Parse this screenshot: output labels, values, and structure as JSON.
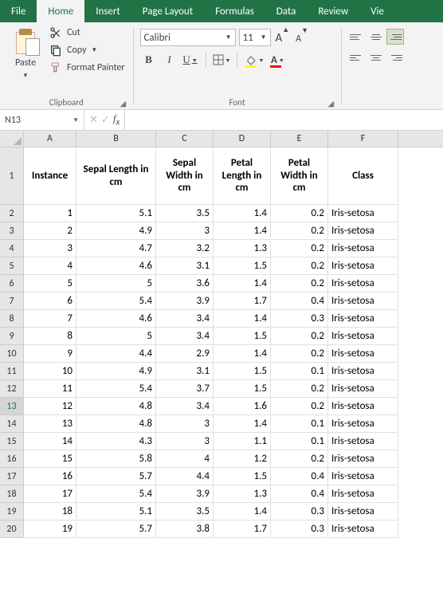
{
  "menu": {
    "items": [
      "File",
      "Home",
      "Insert",
      "Page Layout",
      "Formulas",
      "Data",
      "Review",
      "Vie"
    ],
    "activeIndex": 1
  },
  "ribbon": {
    "clipboard": {
      "paste": "Paste",
      "cut": "Cut",
      "copy": "Copy",
      "formatPainter": "Format Painter",
      "groupLabel": "Clipboard"
    },
    "font": {
      "name": "Calibri",
      "size": "11",
      "groupLabel": "Font"
    }
  },
  "fxbar": {
    "nameBox": "N13",
    "formula": ""
  },
  "grid": {
    "colWidths": {
      "A": 66,
      "B": 100,
      "C": 72,
      "D": 72,
      "E": 72,
      "F": 88
    },
    "columns": [
      "A",
      "B",
      "C",
      "D",
      "E",
      "F"
    ],
    "headerRowHeight": 72,
    "dataRowHeight": 22,
    "selectedRowHeader": 13,
    "headers": [
      "Instance",
      "Sepal Length in cm",
      "Sepal Width in cm",
      "Petal Length in cm",
      "Petal Width in cm",
      "Class"
    ],
    "rows": [
      {
        "r": 2,
        "v": [
          "1",
          "5.1",
          "3.5",
          "1.4",
          "0.2",
          "Iris-setosa"
        ]
      },
      {
        "r": 3,
        "v": [
          "2",
          "4.9",
          "3",
          "1.4",
          "0.2",
          "Iris-setosa"
        ]
      },
      {
        "r": 4,
        "v": [
          "3",
          "4.7",
          "3.2",
          "1.3",
          "0.2",
          "Iris-setosa"
        ]
      },
      {
        "r": 5,
        "v": [
          "4",
          "4.6",
          "3.1",
          "1.5",
          "0.2",
          "Iris-setosa"
        ]
      },
      {
        "r": 6,
        "v": [
          "5",
          "5",
          "3.6",
          "1.4",
          "0.2",
          "Iris-setosa"
        ]
      },
      {
        "r": 7,
        "v": [
          "6",
          "5.4",
          "3.9",
          "1.7",
          "0.4",
          "Iris-setosa"
        ]
      },
      {
        "r": 8,
        "v": [
          "7",
          "4.6",
          "3.4",
          "1.4",
          "0.3",
          "Iris-setosa"
        ]
      },
      {
        "r": 9,
        "v": [
          "8",
          "5",
          "3.4",
          "1.5",
          "0.2",
          "Iris-setosa"
        ]
      },
      {
        "r": 10,
        "v": [
          "9",
          "4.4",
          "2.9",
          "1.4",
          "0.2",
          "Iris-setosa"
        ]
      },
      {
        "r": 11,
        "v": [
          "10",
          "4.9",
          "3.1",
          "1.5",
          "0.1",
          "Iris-setosa"
        ]
      },
      {
        "r": 12,
        "v": [
          "11",
          "5.4",
          "3.7",
          "1.5",
          "0.2",
          "Iris-setosa"
        ]
      },
      {
        "r": 13,
        "v": [
          "12",
          "4.8",
          "3.4",
          "1.6",
          "0.2",
          "Iris-setosa"
        ]
      },
      {
        "r": 14,
        "v": [
          "13",
          "4.8",
          "3",
          "1.4",
          "0.1",
          "Iris-setosa"
        ]
      },
      {
        "r": 15,
        "v": [
          "14",
          "4.3",
          "3",
          "1.1",
          "0.1",
          "Iris-setosa"
        ]
      },
      {
        "r": 16,
        "v": [
          "15",
          "5.8",
          "4",
          "1.2",
          "0.2",
          "Iris-setosa"
        ]
      },
      {
        "r": 17,
        "v": [
          "16",
          "5.7",
          "4.4",
          "1.5",
          "0.4",
          "Iris-setosa"
        ]
      },
      {
        "r": 18,
        "v": [
          "17",
          "5.4",
          "3.9",
          "1.3",
          "0.4",
          "Iris-setosa"
        ]
      },
      {
        "r": 19,
        "v": [
          "18",
          "5.1",
          "3.5",
          "1.4",
          "0.3",
          "Iris-setosa"
        ]
      },
      {
        "r": 20,
        "v": [
          "19",
          "5.7",
          "3.8",
          "1.7",
          "0.3",
          "Iris-setosa"
        ]
      }
    ]
  }
}
